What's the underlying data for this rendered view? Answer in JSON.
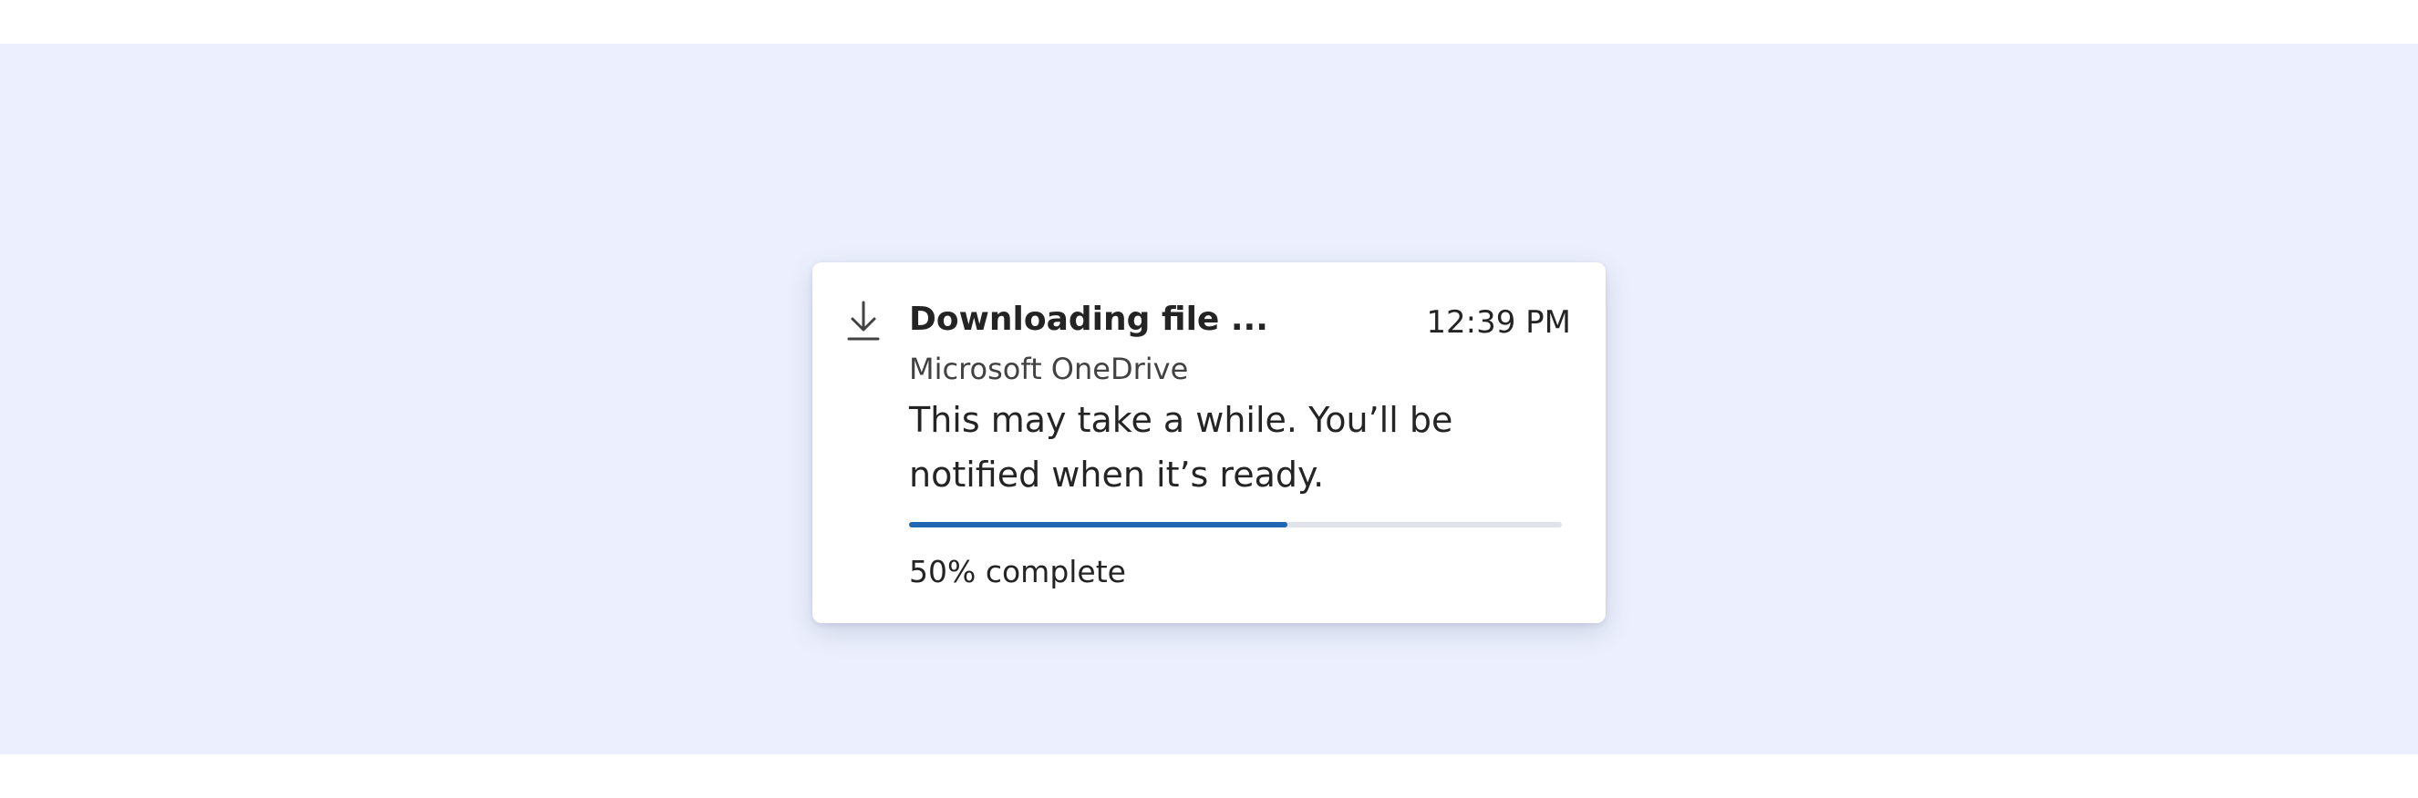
{
  "toast": {
    "icon": "download-icon",
    "title": "Downloading file ...",
    "time": "12:39 PM",
    "app_name": "Microsoft OneDrive",
    "message": "This may take a while. You’ll be notified when it’s ready.",
    "progress": 0.58,
    "status": "50% complete"
  },
  "colors": {
    "page_background": "#ecf0fe",
    "progress_fill": "#1f66b3",
    "progress_track": "#e1e3ea"
  }
}
